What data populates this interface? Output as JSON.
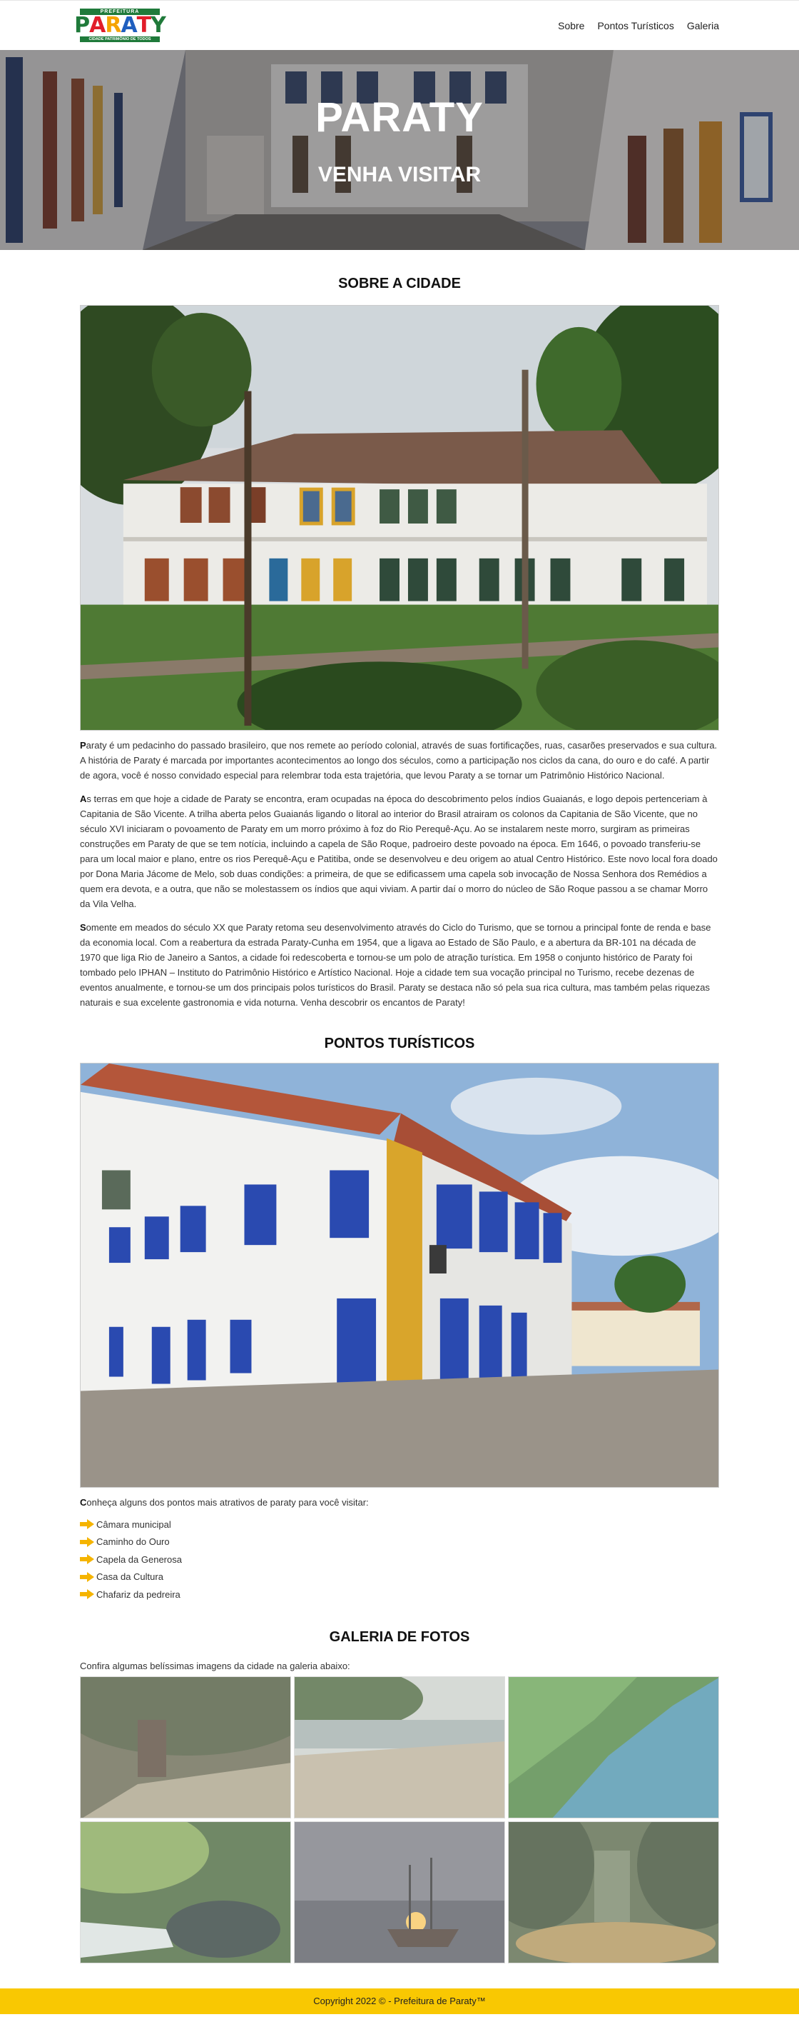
{
  "header": {
    "logo": {
      "top_text": "PREFEITURA",
      "name": "PARATY",
      "bottom_text": "CIDADE PATRIMÔNIO DE TODOS",
      "letter_colors": [
        "#1f7a3a",
        "#e11d2a",
        "#f5a300",
        "#1f5fbf",
        "#e11d2a",
        "#1f7a3a"
      ]
    },
    "nav": [
      "Sobre",
      "Pontos Turísticos",
      "Galeria"
    ]
  },
  "hero": {
    "title": "PARATY",
    "subtitle": "VENHA VISITAR"
  },
  "sobre": {
    "title": "SOBRE A CIDADE",
    "paragraphs": [
      {
        "first": "P",
        "rest": "araty é um pedacinho do passado brasileiro, que nos remete ao período colonial, através de suas fortificações, ruas, casarões preservados e sua cultura. A história de Paraty é marcada por importantes acontecimentos ao longo dos séculos, como a participação nos ciclos da cana, do ouro e do café. A partir de agora, você é nosso convidado especial para relembrar toda esta trajetória, que levou Paraty a se tornar um Patrimônio Histórico Nacional."
      },
      {
        "first": "A",
        "rest": "s terras em que hoje a cidade de Paraty se encontra, eram ocupadas na época do descobrimento pelos índios Guaianás, e logo depois pertenceriam à Capitania de São Vicente. A trilha aberta pelos Guaianás ligando o litoral ao interior do Brasil atrairam os colonos da Capitania de São Vicente, que no século XVI iniciaram o povoamento de Paraty em um morro próximo à foz do Rio Perequê-Açu. Ao se instalarem neste morro, surgiram as primeiras construções em Paraty de que se tem notícia, incluindo a capela de São Roque, padroeiro deste povoado na época. Em 1646, o povoado transferiu-se para um local maior e plano, entre os rios Perequê-Açu e Patitiba, onde se desenvolveu e deu origem ao atual Centro Histórico. Este novo local fora doado por Dona Maria Jácome de Melo, sob duas condições: a primeira, de que se edificassem uma capela sob invocação de Nossa Senhora dos Remédios a quem era devota, e a outra, que não se molestassem os índios que aqui viviam. A partir daí o morro do núcleo de São Roque passou a se chamar Morro da Vila Velha."
      },
      {
        "first": "S",
        "rest": "omente em meados do século XX que Paraty retoma seu desenvolvimento através do Ciclo do Turismo, que se tornou a principal fonte de renda e base da economia local. Com a reabertura da estrada Paraty-Cunha em 1954, que a ligava ao Estado de São Paulo, e a abertura da BR-101 na década de 1970 que liga Rio de Janeiro a Santos, a cidade foi redescoberta e tornou-se um polo de atração turística. Em 1958 o conjunto histórico de Paraty foi tombado pelo IPHAN – Instituto do Patrimônio Histórico e Artístico Nacional. Hoje a cidade tem sua vocação principal no Turismo, recebe dezenas de eventos anualmente, e tornou-se um dos principais polos turísticos do Brasil. Paraty se destaca não só pela sua rica cultura, mas também pelas riquezas naturais e sua excelente gastronomia e vida noturna. Venha descobrir os encantos de Paraty!"
      }
    ]
  },
  "pontos": {
    "title": "PONTOS TURÍSTICOS",
    "intro_first": "C",
    "intro_rest": "onheça alguns dos pontos mais atrativos de paraty para você visitar:",
    "items": [
      "Câmara municipal",
      "Caminho do Ouro",
      "Capela da Generosa",
      "Casa da Cultura",
      "Chafariz da pedreira"
    ],
    "arrow_color": "#f5b400"
  },
  "galeria": {
    "title": "GALERIA DE FOTOS",
    "intro": "Confira algumas belíssimas imagens da cidade na galeria abaixo:"
  },
  "footer": {
    "text": "Copyright 2022 © - Prefeitura de Paraty™"
  }
}
